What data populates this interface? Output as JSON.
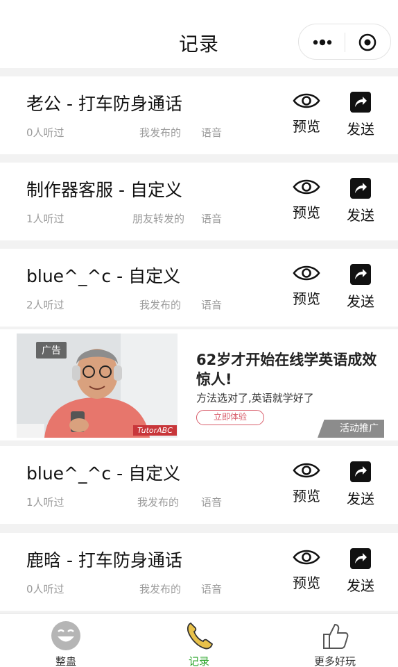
{
  "header": {
    "title": "记录"
  },
  "labels": {
    "preview": "预览",
    "send": "发送"
  },
  "records": [
    {
      "name": "老公 - 打车防身通话",
      "heard": "0人听过",
      "source": "我发布的",
      "type": "语音"
    },
    {
      "name": "制作器客服 - 自定义",
      "heard": "1人听过",
      "source": "朋友转发的",
      "type": "语音"
    },
    {
      "name": "blue^_^c - 自定义",
      "heard": "2人听过",
      "source": "我发布的",
      "type": "语音"
    },
    {
      "name": "blue^_^c - 自定义",
      "heard": "1人听过",
      "source": "我发布的",
      "type": "语音"
    },
    {
      "name": "鹿晗 - 打车防身通话",
      "heard": "0人听过",
      "source": "我发布的",
      "type": "语音"
    }
  ],
  "ad": {
    "tag": "广告",
    "headline": "62岁才开始在线学英语成效惊人!",
    "sub": "方法选对了,英语就学好了",
    "cta": "立即体验",
    "promo": "活动推广",
    "brand": "TutorABC"
  },
  "tabs": [
    {
      "label": "整蛊",
      "icon": "smile-face-icon"
    },
    {
      "label": "记录",
      "icon": "phone-icon"
    },
    {
      "label": "更多好玩",
      "icon": "thumbs-up-icon"
    }
  ],
  "colors": {
    "active_tab": "#2aa52a",
    "cta": "#d85c6a"
  }
}
